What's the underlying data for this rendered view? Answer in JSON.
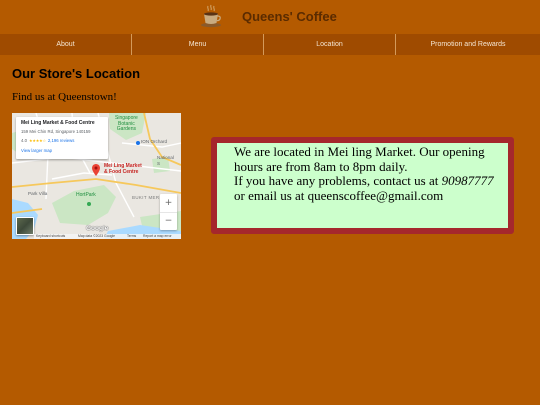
{
  "colors": {
    "page_bg": "#b45a00",
    "nav_bg": "#9f4b00",
    "title": "#5a2b00",
    "box_border": "#a5272c",
    "box_bg": "#ccffcc",
    "map_link": "#1a73e8",
    "map_pin": "#ea4335"
  },
  "header": {
    "logo_icon": "coffee-cup-icon",
    "title": "Queens' Coffee"
  },
  "nav": {
    "items": [
      {
        "label": "About"
      },
      {
        "label": "Menu"
      },
      {
        "label": "Location"
      },
      {
        "label": "Promotion and Rewards"
      }
    ]
  },
  "main": {
    "heading": "Our Store's Location",
    "intro": "Find us at Queenstown!"
  },
  "map": {
    "place_card": {
      "name": "Mei Ling Market & Food Centre",
      "address": "159 Mei Chin Rd, Singapore 140159",
      "rating": "4.0",
      "stars_filled": 4,
      "stars_total": 5,
      "reviews": "2,196 reviews",
      "view_larger": "View larger map"
    },
    "labels": {
      "botanic_1": "Singapore",
      "botanic_2": "Botanic",
      "botanic_3": "Gardens",
      "ion": "ION Orchard",
      "national_1": "National",
      "national_2": "S",
      "pin_1": "Mei Ling Market",
      "pin_2": "& Food Centre",
      "hortpark": "HortPark",
      "park_villa": "Park Villa",
      "bukit": "BUKIT MER"
    },
    "zoom_in": "+",
    "zoom_out": "−",
    "logo": "Google",
    "attribution": {
      "shortcuts": "Keyboard shortcuts",
      "data": "Map data ©2023 Google",
      "terms": "Terms",
      "report": "Report a map error"
    }
  },
  "info_box": {
    "intro": "We are located in Mei ling Market. Our opening hours are from 8am to 8pm daily.",
    "contact_prefix": "If you have any problems, contact us at ",
    "phone": "90987777",
    "email_prefix": "or email us at ",
    "email": "queenscoffee@gmail.com"
  }
}
